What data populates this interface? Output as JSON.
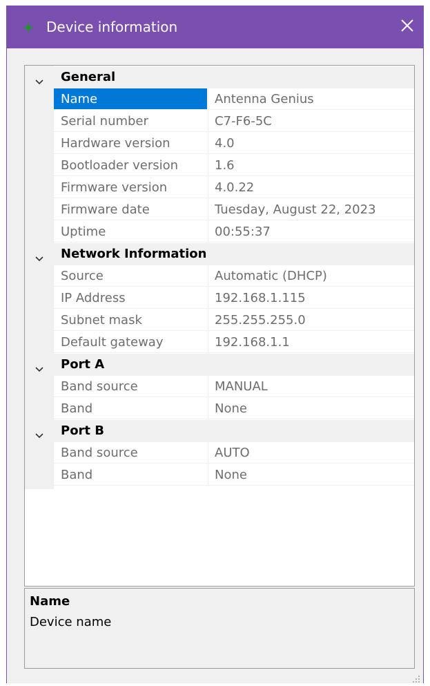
{
  "window": {
    "title": "Device information",
    "close_icon": "close-icon",
    "app_icon": "antenna-icon",
    "titlebar_color": "#7a4fb0"
  },
  "grid": {
    "selected_color": "#0078d7",
    "categories": [
      {
        "label": "General",
        "expanded": true,
        "properties": [
          {
            "name": "Name",
            "value": "Antenna Genius",
            "selected": true
          },
          {
            "name": "Serial number",
            "value": "C7-F6-5C"
          },
          {
            "name": "Hardware version",
            "value": "4.0"
          },
          {
            "name": "Bootloader version",
            "value": "1.6"
          },
          {
            "name": "Firmware version",
            "value": "4.0.22"
          },
          {
            "name": "Firmware date",
            "value": "Tuesday, August 22, 2023"
          },
          {
            "name": "Uptime",
            "value": "00:55:37"
          }
        ]
      },
      {
        "label": "Network Information",
        "expanded": true,
        "properties": [
          {
            "name": "Source",
            "value": "Automatic (DHCP)"
          },
          {
            "name": "IP Address",
            "value": "192.168.1.115"
          },
          {
            "name": "Subnet mask",
            "value": "255.255.255.0"
          },
          {
            "name": "Default gateway",
            "value": "192.168.1.1"
          }
        ]
      },
      {
        "label": "Port A",
        "expanded": true,
        "properties": [
          {
            "name": "Band source",
            "value": "MANUAL"
          },
          {
            "name": "Band",
            "value": "None"
          }
        ]
      },
      {
        "label": "Port B",
        "expanded": true,
        "properties": [
          {
            "name": "Band source",
            "value": "AUTO"
          },
          {
            "name": "Band",
            "value": "None"
          }
        ]
      }
    ]
  },
  "help": {
    "title": "Name",
    "description": "Device name"
  }
}
